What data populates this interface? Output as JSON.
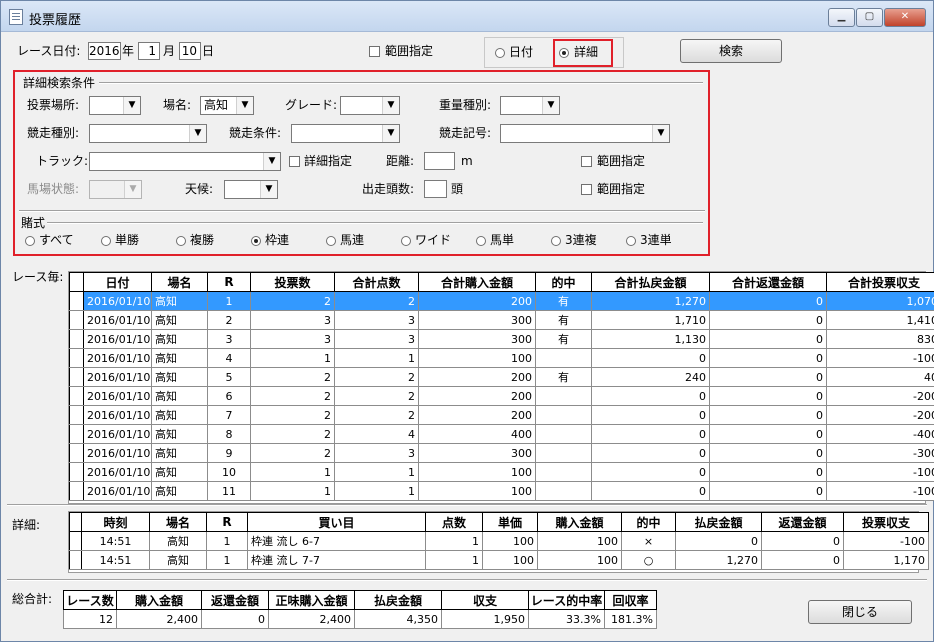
{
  "window": {
    "title": "投票履歴",
    "min": "▁",
    "max": "▢",
    "close": "✕"
  },
  "race_date": {
    "label": "レース日付:",
    "year": "2016",
    "year_unit": "年",
    "month": "1",
    "month_unit": "月",
    "day": "10",
    "day_unit": "日"
  },
  "range_check": {
    "label": "範囲指定",
    "checked": false
  },
  "mode": {
    "date_label": "日付",
    "detail_label": "詳細",
    "selected": "詳細"
  },
  "search_button": "検索",
  "detail_conditions": {
    "legend": "詳細検索条件",
    "venue_label": "投票場所:",
    "venue_value": "",
    "place_label": "場名:",
    "place_value": "高知",
    "grade_label": "グレード:",
    "grade_value": "",
    "weight_label": "重量種別:",
    "weight_value": "",
    "race_type_label": "競走種別:",
    "race_type_value": "",
    "race_cond_label": "競走条件:",
    "race_cond_value": "",
    "race_sym_label": "競走記号:",
    "race_sym_value": "",
    "track_label": "トラック:",
    "track_value": "",
    "track_detail_label": "詳細指定",
    "distance_label": "距離:",
    "distance_value": "",
    "distance_unit": "m",
    "range_label_1": "範囲指定",
    "condition_label": "馬場状態:",
    "condition_value": "",
    "weather_label": "天候:",
    "weather_value": "",
    "runners_label": "出走頭数:",
    "runners_value": "",
    "runners_unit": "頭",
    "range_label_2": "範囲指定"
  },
  "bet_type": {
    "legend": "賭式",
    "options": [
      "すべて",
      "単勝",
      "複勝",
      "枠連",
      "馬連",
      "ワイド",
      "馬単",
      "3連複",
      "3連単"
    ],
    "selected": "枠連"
  },
  "race_table": {
    "label": "レース毎:",
    "columns": [
      "日付",
      "場名",
      "R",
      "投票数",
      "合計点数",
      "合計購入金額",
      "的中",
      "合計払戻金額",
      "合計返還金額",
      "合計投票収支"
    ],
    "rows": [
      [
        "2016/01/10",
        "高知",
        "1",
        "2",
        "2",
        "200",
        "有",
        "1,270",
        "0",
        "1,070"
      ],
      [
        "2016/01/10",
        "高知",
        "2",
        "3",
        "3",
        "300",
        "有",
        "1,710",
        "0",
        "1,410"
      ],
      [
        "2016/01/10",
        "高知",
        "3",
        "3",
        "3",
        "300",
        "有",
        "1,130",
        "0",
        "830"
      ],
      [
        "2016/01/10",
        "高知",
        "4",
        "1",
        "1",
        "100",
        "",
        "0",
        "0",
        "-100"
      ],
      [
        "2016/01/10",
        "高知",
        "5",
        "2",
        "2",
        "200",
        "有",
        "240",
        "0",
        "40"
      ],
      [
        "2016/01/10",
        "高知",
        "6",
        "2",
        "2",
        "200",
        "",
        "0",
        "0",
        "-200"
      ],
      [
        "2016/01/10",
        "高知",
        "7",
        "2",
        "2",
        "200",
        "",
        "0",
        "0",
        "-200"
      ],
      [
        "2016/01/10",
        "高知",
        "8",
        "2",
        "4",
        "400",
        "",
        "0",
        "0",
        "-400"
      ],
      [
        "2016/01/10",
        "高知",
        "9",
        "2",
        "3",
        "300",
        "",
        "0",
        "0",
        "-300"
      ],
      [
        "2016/01/10",
        "高知",
        "10",
        "1",
        "1",
        "100",
        "",
        "0",
        "0",
        "-100"
      ],
      [
        "2016/01/10",
        "高知",
        "11",
        "1",
        "1",
        "100",
        "",
        "0",
        "0",
        "-100"
      ]
    ],
    "selected_row": 0
  },
  "detail_table": {
    "label": "詳細:",
    "columns": [
      "時刻",
      "場名",
      "R",
      "買い目",
      "点数",
      "単価",
      "購入金額",
      "的中",
      "払戻金額",
      "返還金額",
      "投票収支"
    ],
    "rows": [
      [
        "14:51",
        "高知",
        "1",
        "枠連 流し 6-7",
        "1",
        "100",
        "100",
        "×",
        "0",
        "0",
        "-100"
      ],
      [
        "14:51",
        "高知",
        "1",
        "枠連 流し 7-7",
        "1",
        "100",
        "100",
        "○",
        "1,270",
        "0",
        "1,170"
      ]
    ]
  },
  "totals": {
    "label": "総合計:",
    "columns": [
      "レース数",
      "購入金額",
      "返還金額",
      "正味購入金額",
      "払戻金額",
      "収支",
      "レース的中率",
      "回収率"
    ],
    "values": [
      "12",
      "2,400",
      "0",
      "2,400",
      "4,350",
      "1,950",
      "33.3%",
      "181.3%"
    ]
  },
  "close_button": "閉じる"
}
